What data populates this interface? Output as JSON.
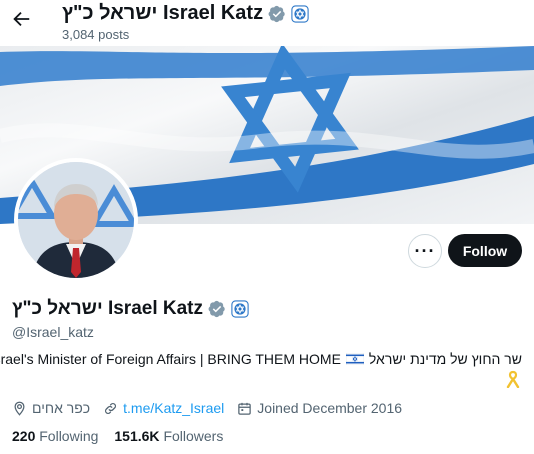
{
  "header": {
    "back_icon": "arrow-left-icon",
    "title": "ישראל כ\"ץ Israel Katz",
    "posts_count": "3,084 posts"
  },
  "profile": {
    "display_name": "ישראל כ\"ץ Israel Katz",
    "handle": "@Israel_katz",
    "bio_text": "Israel's Minister of Foreign Affairs | BRING THEM HOME",
    "bio_hebrew": "שר החוץ של מדינת ישראל",
    "location": "כפר אחים",
    "website": "t.me/Katz_Israel",
    "joined": "Joined December 2016",
    "following_count": "220",
    "following_label": "Following",
    "followers_count": "151.6K",
    "followers_label": "Followers"
  },
  "actions": {
    "more_label": "···",
    "follow_label": "Follow"
  },
  "icons": {
    "verified": "gray-verified-badge-icon",
    "affiliate": "government-affiliate-icon",
    "location": "location-pin-icon",
    "link": "link-icon",
    "calendar": "calendar-icon",
    "ribbon": "yellow-ribbon-icon",
    "flag": "israel-flag-icon"
  },
  "colors": {
    "accent_link": "#1d9bf0",
    "muted_text": "#536471",
    "follow_button_bg": "#0f1419",
    "flag_blue": "#2d78c8",
    "verified_gray": "#829aab"
  }
}
